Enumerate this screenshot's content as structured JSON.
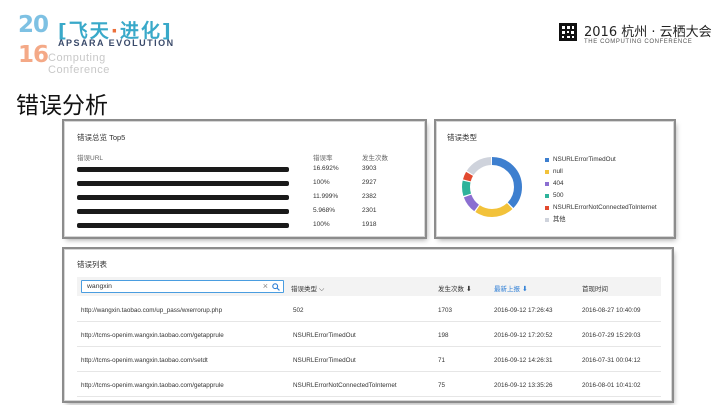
{
  "branding": {
    "year_top": "20",
    "year_bottom": "16",
    "event_cn": [
      "飞",
      "天",
      "·",
      "进",
      "化"
    ],
    "event_en": "APSARA EVOLUTION",
    "faded_1": "Computing",
    "faded_2": "Conference",
    "right_main": "2016 杭州 · 云栖大会",
    "right_sub": "THE COMPUTING CONFERENCE"
  },
  "slide_title": "错误分析",
  "top5": {
    "title": "错误总览 Top5",
    "headers": {
      "url": "错误URL",
      "rate": "错误率",
      "count": "发生次数"
    },
    "rows": [
      {
        "rate": "16.692%",
        "count": "3903"
      },
      {
        "rate": "100%",
        "count": "2927"
      },
      {
        "rate": "11.999%",
        "count": "2382"
      },
      {
        "rate": "5.968%",
        "count": "2301"
      },
      {
        "rate": "100%",
        "count": "1918"
      }
    ]
  },
  "types": {
    "title": "错误类型",
    "legend": [
      {
        "label": "NSURLErrorTimedOut",
        "color": "#3d7fcf",
        "share": 0.38
      },
      {
        "label": "null",
        "color": "#f2c23a",
        "share": 0.22
      },
      {
        "label": "404",
        "color": "#8b6fd1",
        "share": 0.1
      },
      {
        "label": "500",
        "color": "#2fb39b",
        "share": 0.09
      },
      {
        "label": "NSURLErrorNotConnectedToInternet",
        "color": "#e2492f",
        "share": 0.05
      },
      {
        "label": "其他",
        "color": "#cfd3dc",
        "share": 0.16
      }
    ]
  },
  "list": {
    "title": "错误列表",
    "search_value": "wangxin",
    "headers": {
      "type": "错误类型",
      "count": "发生次数",
      "latest": "最新上报",
      "first": "首现时间"
    },
    "rows": [
      {
        "url": "http://wangxin.taobao.com/up_pass/wxerrorup.php",
        "type": "502",
        "count": "1703",
        "latest": "2016-09-12 17:26:43",
        "first": "2016-08-27 10:40:09"
      },
      {
        "url": "http://tcms-openim.wangxin.taobao.com/getapprule",
        "type": "NSURLErrorTimedOut",
        "count": "198",
        "latest": "2016-09-12 17:20:52",
        "first": "2016-07-29 15:29:03"
      },
      {
        "url": "http://tcms-openim.wangxin.taobao.com/setdt",
        "type": "NSURLErrorTimedOut",
        "count": "71",
        "latest": "2016-09-12 14:26:31",
        "first": "2016-07-31 00:04:12"
      },
      {
        "url": "http://tcms-openim.wangxin.taobao.com/getapprule",
        "type": "NSURLErrorNotConnectedToInternet",
        "count": "75",
        "latest": "2016-09-12 13:35:26",
        "first": "2016-08-01 10:41:02"
      }
    ]
  }
}
